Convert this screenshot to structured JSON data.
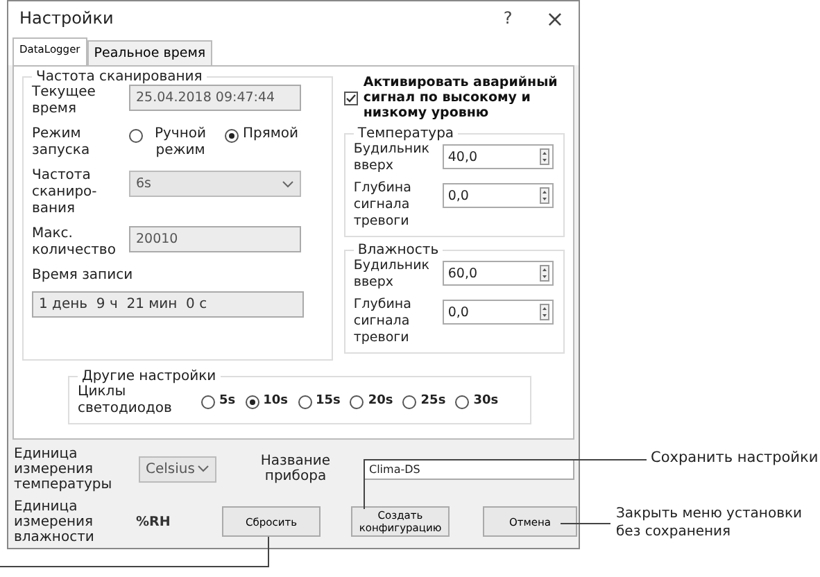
{
  "window": {
    "title": "Настройки",
    "help": "?",
    "close": "×"
  },
  "tabs": [
    {
      "label": "DataLogger",
      "selected": true
    },
    {
      "label": "Реальное время",
      "selected": false
    }
  ],
  "scan": {
    "title": "Частота сканирования",
    "current_time": {
      "label": "Текущее время",
      "value": "25.04.2018 09:47:44"
    },
    "start_mode": {
      "label": "Режим запуска",
      "options": [
        {
          "label": "Ручной режим",
          "selected": false
        },
        {
          "label": "Прямой",
          "selected": true
        }
      ]
    },
    "scan_rate": {
      "label": "Частота сканиро-вания",
      "value": "6s"
    },
    "max_count": {
      "label": "Макс. количество",
      "value": "20010"
    },
    "record_time": {
      "label": "Время записи",
      "value": "1 день  9 ч  21 мин  0 с"
    }
  },
  "alarm": {
    "checked": true,
    "label": "Активировать аварийный сигнал по высокому и низкому уровню"
  },
  "groups": [
    {
      "title": "Температура",
      "high_label": "Будильник вверх",
      "high": "40,0",
      "low_label": "Глубина сигнала тревоги",
      "low": "0,0"
    },
    {
      "title": "Влажность",
      "high_label": "Будильник вверх",
      "high": "60,0",
      "low_label": "Глубина сигнала тревоги",
      "low": "0,0"
    }
  ],
  "other": {
    "title": "Другие настройки",
    "label": "Циклы светодиодов",
    "options": [
      {
        "label": "5s",
        "selected": false
      },
      {
        "label": "10s",
        "selected": true
      },
      {
        "label": "15s",
        "selected": false
      },
      {
        "label": "20s",
        "selected": false
      },
      {
        "label": "25s",
        "selected": false
      },
      {
        "label": "30s",
        "selected": false
      }
    ]
  },
  "bottom": {
    "temp_unit_label": "Единица измерения температуры",
    "temp_unit": "Celsius",
    "device_label": "Название прибора",
    "device": "Clima-DS",
    "hum_unit_label": "Единица измерения влажности",
    "hum_unit": "%RH",
    "buttons": [
      "Сбросить",
      "Создать конфигурацию",
      "Отмена"
    ]
  },
  "callouts": [
    "Сохранить настройки",
    "Закрыть меню установки без сохранения"
  ]
}
